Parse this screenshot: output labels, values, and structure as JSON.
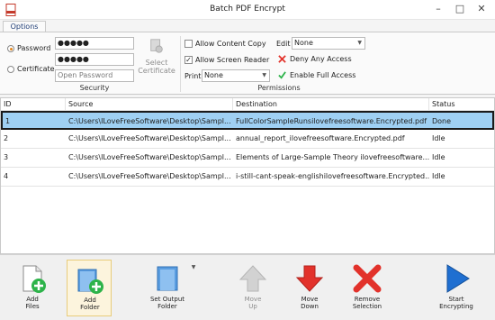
{
  "window": {
    "title": "Batch PDF Encrypt"
  },
  "tabs": [
    {
      "label": "Options"
    }
  ],
  "security": {
    "password_label": "Password",
    "certificate_label": "Certificate",
    "password_value": "●●●●●",
    "confirm_value": "●●●●●",
    "open_password_placeholder": "Open Password",
    "select_certificate_line1": "Select",
    "select_certificate_line2": "Certificate",
    "group_label": "Security"
  },
  "permissions": {
    "allow_content_copy": "Allow Content Copy",
    "allow_screen_reader": "Allow Screen Reader",
    "print_label": "Print",
    "print_value": "None",
    "edit_label": "Edit",
    "edit_value": "None",
    "deny_any_access": "Deny Any Access",
    "enable_full_access": "Enable Full Access",
    "group_label": "Permissions",
    "allow_content_copy_checked": false,
    "allow_screen_reader_checked": true
  },
  "table": {
    "columns": [
      "ID",
      "Source",
      "Destination",
      "Status"
    ],
    "rows": [
      {
        "id": "1",
        "source": "C:\\Users\\ILoveFreeSoftware\\Desktop\\Sampl...",
        "destination": "FullColorSampleRunsilovefreesoftware.Encrypted.pdf",
        "status": "Done"
      },
      {
        "id": "2",
        "source": "C:\\Users\\ILoveFreeSoftware\\Desktop\\Sampl...",
        "destination": "annual_report_ilovefreesoftware.Encrypted.pdf",
        "status": "Idle"
      },
      {
        "id": "3",
        "source": "C:\\Users\\ILoveFreeSoftware\\Desktop\\Sampl...",
        "destination": "Elements of Large-Sample Theory ilovefreesoftware...",
        "status": "Idle"
      },
      {
        "id": "4",
        "source": "C:\\Users\\ILoveFreeSoftware\\Desktop\\Sampl...",
        "destination": "i-still-cant-speak-englishilovefreesoftware.Encrypted...",
        "status": "Idle"
      }
    ]
  },
  "toolbar": {
    "add_files": [
      "Add",
      "Files"
    ],
    "add_folder": [
      "Add",
      "Folder"
    ],
    "set_output_folder": [
      "Set Output",
      "Folder"
    ],
    "move_up": [
      "Move",
      "Up"
    ],
    "move_down": [
      "Move",
      "Down"
    ],
    "remove_selection": [
      "Remove",
      "Selection"
    ],
    "start_encrypting": [
      "Start",
      "Encrypting"
    ]
  },
  "colors": {
    "selected_row": "#9fd0f3",
    "accent_green": "#2db34a",
    "accent_red": "#e2322b",
    "accent_blue": "#1f6fd1",
    "radio_on": "#e3861c"
  }
}
